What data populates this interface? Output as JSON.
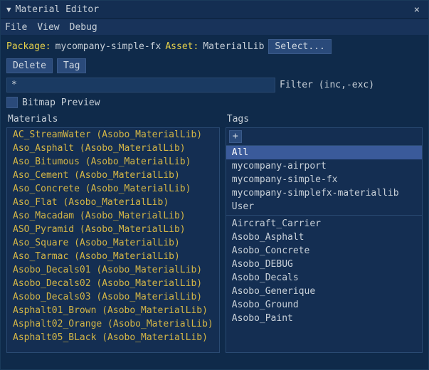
{
  "window": {
    "title": "Material Editor",
    "close": "×"
  },
  "menu": {
    "file": "File",
    "view": "View",
    "debug": "Debug"
  },
  "package": {
    "label": "Package:",
    "value": "mycompany-simple-fx",
    "asset_label": "Asset:",
    "asset_value": "MaterialLib",
    "select_btn": "Select..."
  },
  "actions": {
    "delete": "Delete",
    "tag": "Tag"
  },
  "filter": {
    "value": "*",
    "label": "Filter (inc,-exc)"
  },
  "bitmap_label": "Bitmap Preview",
  "materials": {
    "header": "Materials",
    "items": [
      "AC_StreamWater (Asobo_MaterialLib)",
      "Aso_Asphalt (Asobo_MaterialLib)",
      "Aso_Bitumous (Asobo_MaterialLib)",
      "Aso_Cement (Asobo_MaterialLib)",
      "Aso_Concrete (Asobo_MaterialLib)",
      "Aso_Flat (Asobo_MaterialLib)",
      "Aso_Macadam (Asobo_MaterialLib)",
      "ASO_Pyramid (Asobo_MaterialLib)",
      "Aso_Square (Asobo_MaterialLib)",
      "Aso_Tarmac (Asobo_MaterialLib)",
      "Asobo_Decals01 (Asobo_MaterialLib)",
      "Asobo_Decals02 (Asobo_MaterialLib)",
      "Asobo_Decals03 (Asobo_MaterialLib)",
      "Asphalt01_Brown (Asobo_MaterialLib)",
      "Asphalt02_Orange (Asobo_MaterialLib)",
      "Asphalt05_BLack (Asobo_MaterialLib)"
    ]
  },
  "tags": {
    "header": "Tags",
    "plus": "+",
    "group1": [
      "All",
      "mycompany-airport",
      "mycompany-simple-fx",
      "mycompany-simplefx-materiallib",
      "User"
    ],
    "group2": [
      "Aircraft_Carrier",
      "Asobo_Asphalt",
      "Asobo_Concrete",
      "Asobo_DEBUG",
      "Asobo_Decals",
      "Asobo_Generique",
      "Asobo_Ground",
      "Asobo_Paint"
    ],
    "selected": "All"
  }
}
